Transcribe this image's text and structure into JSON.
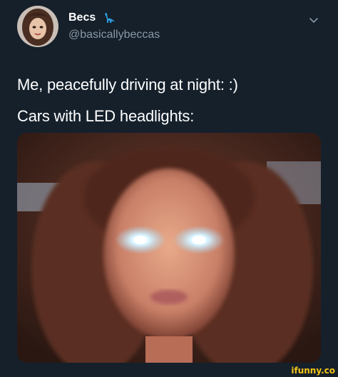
{
  "header": {
    "display_name": "Becs",
    "handle": "@basicallybeccas",
    "name_emoji_icon": "dinosaur-icon",
    "menu_icon": "chevron-down-icon"
  },
  "tweet": {
    "line1": "Me, peacefully driving at night: :)",
    "line2": "Cars with LED headlights:"
  },
  "media": {
    "description_icon": "photo"
  },
  "watermark": "ifunny.co",
  "colors": {
    "background": "#15202b",
    "text": "#ffffff",
    "secondary_text": "#8899a6",
    "watermark": "#f5c518"
  }
}
